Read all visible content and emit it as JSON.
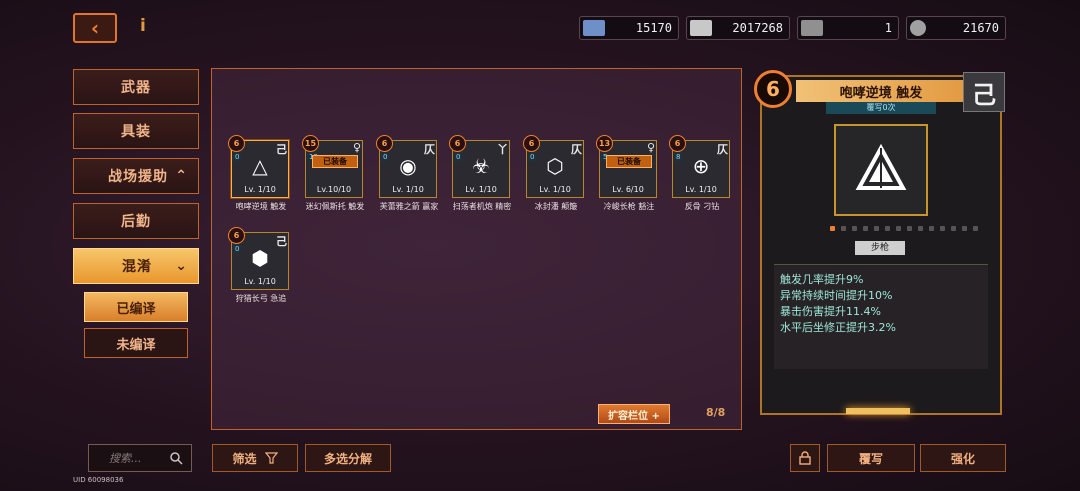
{
  "top_bar": {
    "back_icon": "back-arrow-icon",
    "info_label": "i",
    "currencies": [
      {
        "icon": "crate-icon",
        "value": "15170",
        "color": "#6f8fc8"
      },
      {
        "icon": "banknote-icon",
        "value": "2017268",
        "color": "#c8c8c8"
      },
      {
        "icon": "ammo-icon",
        "value": "1",
        "color": "#909090"
      },
      {
        "icon": "gear-icon",
        "value": "21670",
        "color": "#a0a0a0"
      }
    ]
  },
  "sidebar": {
    "items": [
      {
        "label": "武器"
      },
      {
        "label": "具装"
      },
      {
        "label": "战场援助"
      },
      {
        "label": "后勤"
      },
      {
        "label": "混淆"
      }
    ],
    "sub_items": [
      {
        "label": "已编译"
      },
      {
        "label": "未编译"
      }
    ]
  },
  "grid": {
    "cards": [
      {
        "level": "6",
        "count": "0",
        "corner": "己",
        "lv": "Lv. 1/10",
        "name": "咆哮逆境 触发",
        "equipped": ""
      },
      {
        "level": "15",
        "count": "19",
        "corner": "♀",
        "lv": "Lv.10/10",
        "name": "迷幻佩斯托 触发",
        "equipped": "已装备"
      },
      {
        "level": "6",
        "count": "0",
        "corner": "仄",
        "lv": "Lv. 1/10",
        "name": "芙蕾雅之箭 赢家",
        "equipped": ""
      },
      {
        "level": "6",
        "count": "0",
        "corner": "丫",
        "lv": "Lv. 1/10",
        "name": "扫荡者机炮 精密",
        "equipped": ""
      },
      {
        "level": "6",
        "count": "0",
        "corner": "仄",
        "lv": "Lv. 1/10",
        "name": "冰封潘 颠簸",
        "equipped": ""
      },
      {
        "level": "13",
        "count": "5",
        "corner": "♀",
        "lv": "Lv. 6/10",
        "name": "冷峻长枪 豁注",
        "equipped": "已装备"
      },
      {
        "level": "6",
        "count": "8",
        "corner": "仄",
        "lv": "Lv. 1/10",
        "name": "反骨 刁钻",
        "equipped": ""
      },
      {
        "level": "6",
        "count": "0",
        "corner": "己",
        "lv": "Lv. 1/10",
        "name": "狩猎长弓 急追",
        "equipped": ""
      }
    ],
    "expand_label": "扩容栏位 +",
    "slot_count": "8/8"
  },
  "detail": {
    "level": "6",
    "title": "咆哮逆境 触发",
    "rewrite": "覆写0次",
    "type_glyph": "己",
    "weapon_type": "步枪",
    "stats": [
      {
        "label": "触发几率提升",
        "value": "9%"
      },
      {
        "label": "异常持续时间提升",
        "value": "10%"
      },
      {
        "label": "暴击伤害提升",
        "value": "11.4%"
      },
      {
        "label": "水平后坐修正提升",
        "value": "3.2%"
      }
    ]
  },
  "bottom": {
    "search_placeholder": "搜索...",
    "uid": "UID 60098036",
    "filter_label": "筛选",
    "multi_label": "多选分解",
    "rewrite_label": "覆写",
    "enhance_label": "强化"
  }
}
